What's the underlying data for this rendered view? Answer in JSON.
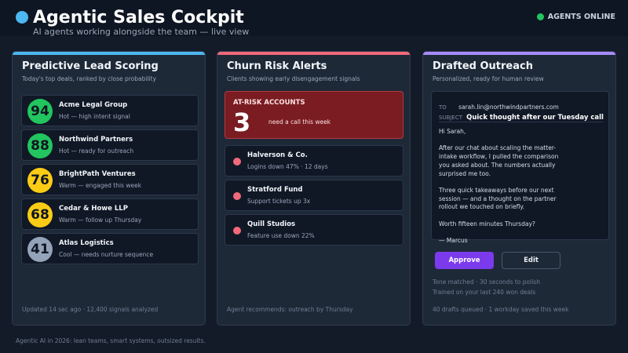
{
  "header": {
    "title": "Agentic Sales Cockpit",
    "subtitle": "AI agents working alongside the team — live view",
    "status": "AGENTS ONLINE"
  },
  "colors": {
    "lead_accent": "#4cb7f0",
    "churn_accent": "#f06a7a",
    "outreach_accent": "#a78bfa",
    "score_hot": "#22c55e",
    "score_warm": "#facc15",
    "score_cool": "#94a3b8",
    "approve": "#7c3aed"
  },
  "lead_panel": {
    "title": "Predictive Lead Scoring",
    "subtitle": "Today's top deals, ranked by close probability",
    "leads": [
      {
        "score": "94",
        "name": "Acme Legal Group",
        "desc": "Hot — high intent signal",
        "tier": "hot"
      },
      {
        "score": "88",
        "name": "Northwind Partners",
        "desc": "Hot — ready for outreach",
        "tier": "hot"
      },
      {
        "score": "76",
        "name": "BrightPath Ventures",
        "desc": "Warm — engaged this week",
        "tier": "warm"
      },
      {
        "score": "68",
        "name": "Cedar & Howe LLP",
        "desc": "Warm — follow up Thursday",
        "tier": "warm"
      },
      {
        "score": "41",
        "name": "Atlas Logistics",
        "desc": "Cool — needs nurture sequence",
        "tier": "cool"
      }
    ],
    "footer": "Updated 14 sec ago · 12,400 signals analyzed"
  },
  "churn_panel": {
    "title": "Churn Risk Alerts",
    "subtitle": "Clients showing early disengagement signals",
    "at_risk_label": "AT-RISK ACCOUNTS",
    "at_risk_count": "3",
    "at_risk_note": "need a call this week",
    "alerts": [
      {
        "name": "Halverson & Co.",
        "desc": "Logins down 47% · 12 days"
      },
      {
        "name": "Stratford Fund",
        "desc": "Support tickets up 3x"
      },
      {
        "name": "Quill Studios",
        "desc": "Feature use down 22%"
      }
    ],
    "footer": "Agent recommends: outreach by Thursday"
  },
  "outreach_panel": {
    "title": "Drafted Outreach",
    "subtitle": "Personalized, ready for human review",
    "email": {
      "to_label": "TO",
      "to": "sarah.lin@northwindpartners.com",
      "subject_label": "SUBJECT",
      "subject": "Quick thought after our Tuesday call",
      "body": [
        [
          "Hi Sarah,"
        ],
        [
          "After our chat about scaling the matter-",
          "intake workflow, I pulled the comparison",
          "you asked about. The numbers actually",
          "surprised me too."
        ],
        [
          "Three quick takeaways before our next",
          "session — and a thought on the partner",
          "rollout we touched on briefly."
        ],
        [
          "Worth fifteen minutes Thursday?"
        ],
        [
          "— Marcus"
        ]
      ]
    },
    "approve_label": "Approve",
    "edit_label": "Edit",
    "tone_note": "Tone matched · 30 seconds to polish",
    "trained_note": "Trained on your last 240 won deals",
    "footer": "40 drafts queued · 1 workday saved this week"
  },
  "page_footer": "Agentic AI in 2026: lean teams, smart systems, outsized results."
}
